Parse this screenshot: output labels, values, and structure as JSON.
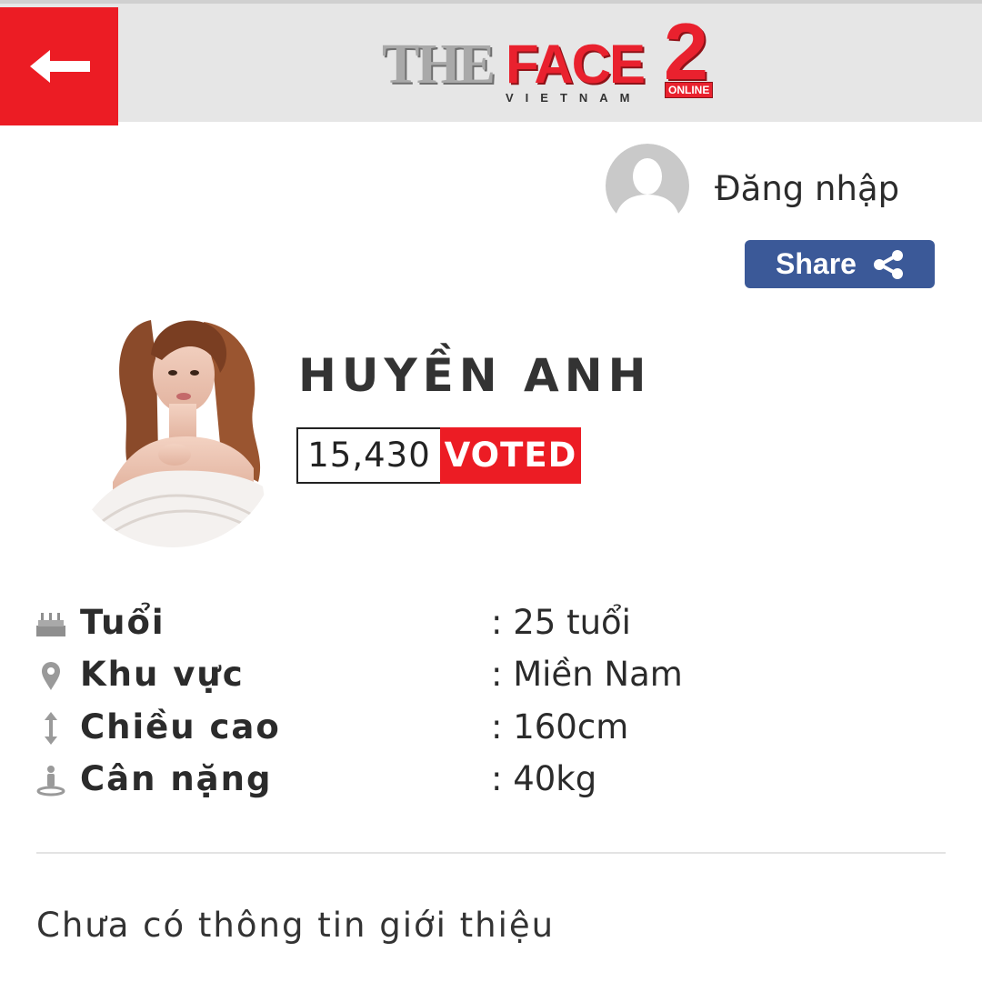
{
  "header": {
    "logo": {
      "the": "THE",
      "face": "FACE",
      "number": "2",
      "sub": "VIETNAM",
      "badge": "ONLINE"
    },
    "back_icon": "arrow-left-icon",
    "colors": {
      "brand_red": "#ec1c24",
      "bar_bg": "#e6e6e6"
    }
  },
  "account": {
    "login_label": "Đăng nhập",
    "avatar_icon": "user-silhouette-icon"
  },
  "share": {
    "label": "Share",
    "icon": "share-icon",
    "color": "#3b5998"
  },
  "profile": {
    "name": "HUYỀN ANH",
    "votes": "15,430",
    "voted_label": "VOTED"
  },
  "info": [
    {
      "icon": "cake-icon",
      "label": "Tuổi",
      "value": ": 25 tuổi"
    },
    {
      "icon": "map-pin-icon",
      "label": "Khu vực",
      "value": ": Miền Nam"
    },
    {
      "icon": "height-arrow-icon",
      "label": "Chiều cao",
      "value": ": 160cm"
    },
    {
      "icon": "scale-icon",
      "label": "Cân nặng",
      "value": ": 40kg"
    }
  ],
  "bio": "Chưa có thông tin giới thiệu"
}
